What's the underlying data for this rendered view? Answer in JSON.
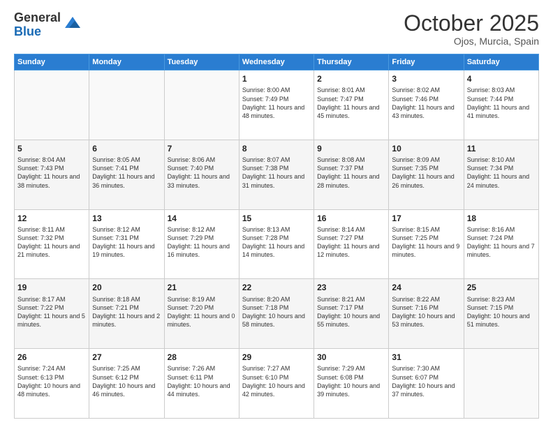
{
  "header": {
    "logo_general": "General",
    "logo_blue": "Blue",
    "month_title": "October 2025",
    "location": "Ojos, Murcia, Spain"
  },
  "weekdays": [
    "Sunday",
    "Monday",
    "Tuesday",
    "Wednesday",
    "Thursday",
    "Friday",
    "Saturday"
  ],
  "weeks": [
    {
      "alt": false,
      "days": [
        {
          "num": "",
          "sunrise": "",
          "sunset": "",
          "daylight": ""
        },
        {
          "num": "",
          "sunrise": "",
          "sunset": "",
          "daylight": ""
        },
        {
          "num": "",
          "sunrise": "",
          "sunset": "",
          "daylight": ""
        },
        {
          "num": "1",
          "sunrise": "Sunrise: 8:00 AM",
          "sunset": "Sunset: 7:49 PM",
          "daylight": "Daylight: 11 hours and 48 minutes."
        },
        {
          "num": "2",
          "sunrise": "Sunrise: 8:01 AM",
          "sunset": "Sunset: 7:47 PM",
          "daylight": "Daylight: 11 hours and 45 minutes."
        },
        {
          "num": "3",
          "sunrise": "Sunrise: 8:02 AM",
          "sunset": "Sunset: 7:46 PM",
          "daylight": "Daylight: 11 hours and 43 minutes."
        },
        {
          "num": "4",
          "sunrise": "Sunrise: 8:03 AM",
          "sunset": "Sunset: 7:44 PM",
          "daylight": "Daylight: 11 hours and 41 minutes."
        }
      ]
    },
    {
      "alt": true,
      "days": [
        {
          "num": "5",
          "sunrise": "Sunrise: 8:04 AM",
          "sunset": "Sunset: 7:43 PM",
          "daylight": "Daylight: 11 hours and 38 minutes."
        },
        {
          "num": "6",
          "sunrise": "Sunrise: 8:05 AM",
          "sunset": "Sunset: 7:41 PM",
          "daylight": "Daylight: 11 hours and 36 minutes."
        },
        {
          "num": "7",
          "sunrise": "Sunrise: 8:06 AM",
          "sunset": "Sunset: 7:40 PM",
          "daylight": "Daylight: 11 hours and 33 minutes."
        },
        {
          "num": "8",
          "sunrise": "Sunrise: 8:07 AM",
          "sunset": "Sunset: 7:38 PM",
          "daylight": "Daylight: 11 hours and 31 minutes."
        },
        {
          "num": "9",
          "sunrise": "Sunrise: 8:08 AM",
          "sunset": "Sunset: 7:37 PM",
          "daylight": "Daylight: 11 hours and 28 minutes."
        },
        {
          "num": "10",
          "sunrise": "Sunrise: 8:09 AM",
          "sunset": "Sunset: 7:35 PM",
          "daylight": "Daylight: 11 hours and 26 minutes."
        },
        {
          "num": "11",
          "sunrise": "Sunrise: 8:10 AM",
          "sunset": "Sunset: 7:34 PM",
          "daylight": "Daylight: 11 hours and 24 minutes."
        }
      ]
    },
    {
      "alt": false,
      "days": [
        {
          "num": "12",
          "sunrise": "Sunrise: 8:11 AM",
          "sunset": "Sunset: 7:32 PM",
          "daylight": "Daylight: 11 hours and 21 minutes."
        },
        {
          "num": "13",
          "sunrise": "Sunrise: 8:12 AM",
          "sunset": "Sunset: 7:31 PM",
          "daylight": "Daylight: 11 hours and 19 minutes."
        },
        {
          "num": "14",
          "sunrise": "Sunrise: 8:12 AM",
          "sunset": "Sunset: 7:29 PM",
          "daylight": "Daylight: 11 hours and 16 minutes."
        },
        {
          "num": "15",
          "sunrise": "Sunrise: 8:13 AM",
          "sunset": "Sunset: 7:28 PM",
          "daylight": "Daylight: 11 hours and 14 minutes."
        },
        {
          "num": "16",
          "sunrise": "Sunrise: 8:14 AM",
          "sunset": "Sunset: 7:27 PM",
          "daylight": "Daylight: 11 hours and 12 minutes."
        },
        {
          "num": "17",
          "sunrise": "Sunrise: 8:15 AM",
          "sunset": "Sunset: 7:25 PM",
          "daylight": "Daylight: 11 hours and 9 minutes."
        },
        {
          "num": "18",
          "sunrise": "Sunrise: 8:16 AM",
          "sunset": "Sunset: 7:24 PM",
          "daylight": "Daylight: 11 hours and 7 minutes."
        }
      ]
    },
    {
      "alt": true,
      "days": [
        {
          "num": "19",
          "sunrise": "Sunrise: 8:17 AM",
          "sunset": "Sunset: 7:22 PM",
          "daylight": "Daylight: 11 hours and 5 minutes."
        },
        {
          "num": "20",
          "sunrise": "Sunrise: 8:18 AM",
          "sunset": "Sunset: 7:21 PM",
          "daylight": "Daylight: 11 hours and 2 minutes."
        },
        {
          "num": "21",
          "sunrise": "Sunrise: 8:19 AM",
          "sunset": "Sunset: 7:20 PM",
          "daylight": "Daylight: 11 hours and 0 minutes."
        },
        {
          "num": "22",
          "sunrise": "Sunrise: 8:20 AM",
          "sunset": "Sunset: 7:18 PM",
          "daylight": "Daylight: 10 hours and 58 minutes."
        },
        {
          "num": "23",
          "sunrise": "Sunrise: 8:21 AM",
          "sunset": "Sunset: 7:17 PM",
          "daylight": "Daylight: 10 hours and 55 minutes."
        },
        {
          "num": "24",
          "sunrise": "Sunrise: 8:22 AM",
          "sunset": "Sunset: 7:16 PM",
          "daylight": "Daylight: 10 hours and 53 minutes."
        },
        {
          "num": "25",
          "sunrise": "Sunrise: 8:23 AM",
          "sunset": "Sunset: 7:15 PM",
          "daylight": "Daylight: 10 hours and 51 minutes."
        }
      ]
    },
    {
      "alt": false,
      "days": [
        {
          "num": "26",
          "sunrise": "Sunrise: 7:24 AM",
          "sunset": "Sunset: 6:13 PM",
          "daylight": "Daylight: 10 hours and 48 minutes."
        },
        {
          "num": "27",
          "sunrise": "Sunrise: 7:25 AM",
          "sunset": "Sunset: 6:12 PM",
          "daylight": "Daylight: 10 hours and 46 minutes."
        },
        {
          "num": "28",
          "sunrise": "Sunrise: 7:26 AM",
          "sunset": "Sunset: 6:11 PM",
          "daylight": "Daylight: 10 hours and 44 minutes."
        },
        {
          "num": "29",
          "sunrise": "Sunrise: 7:27 AM",
          "sunset": "Sunset: 6:10 PM",
          "daylight": "Daylight: 10 hours and 42 minutes."
        },
        {
          "num": "30",
          "sunrise": "Sunrise: 7:29 AM",
          "sunset": "Sunset: 6:08 PM",
          "daylight": "Daylight: 10 hours and 39 minutes."
        },
        {
          "num": "31",
          "sunrise": "Sunrise: 7:30 AM",
          "sunset": "Sunset: 6:07 PM",
          "daylight": "Daylight: 10 hours and 37 minutes."
        },
        {
          "num": "",
          "sunrise": "",
          "sunset": "",
          "daylight": ""
        }
      ]
    }
  ]
}
